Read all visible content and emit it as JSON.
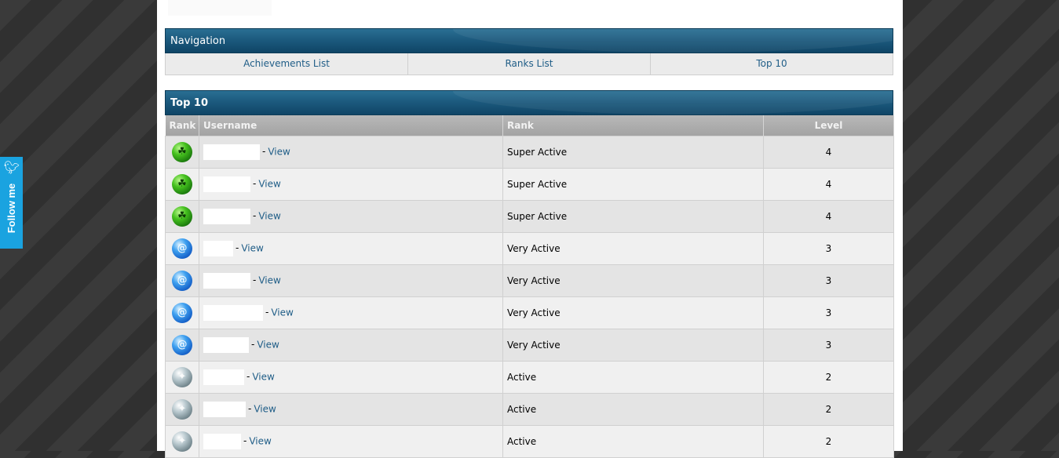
{
  "navigation": {
    "title": "Navigation",
    "items": [
      "Achievements List",
      "Ranks List",
      "Top 10"
    ]
  },
  "top10": {
    "title": "Top 10",
    "columns": [
      "Rank",
      "Username",
      "Rank",
      "Level"
    ],
    "view_label": "View",
    "rows": [
      {
        "badge": "green",
        "rank": "Super Active",
        "level": "4"
      },
      {
        "badge": "green",
        "rank": "Super Active",
        "level": "4"
      },
      {
        "badge": "green",
        "rank": "Super Active",
        "level": "4"
      },
      {
        "badge": "blue",
        "rank": "Very Active",
        "level": "3"
      },
      {
        "badge": "blue",
        "rank": "Very Active",
        "level": "3"
      },
      {
        "badge": "blue",
        "rank": "Very Active",
        "level": "3"
      },
      {
        "badge": "blue",
        "rank": "Very Active",
        "level": "3"
      },
      {
        "badge": "grey",
        "rank": "Active",
        "level": "2"
      },
      {
        "badge": "grey",
        "rank": "Active",
        "level": "2"
      },
      {
        "badge": "grey",
        "rank": "Active",
        "level": "2"
      }
    ]
  },
  "follow": {
    "label": "Follow me",
    "icon": "bird-icon"
  }
}
